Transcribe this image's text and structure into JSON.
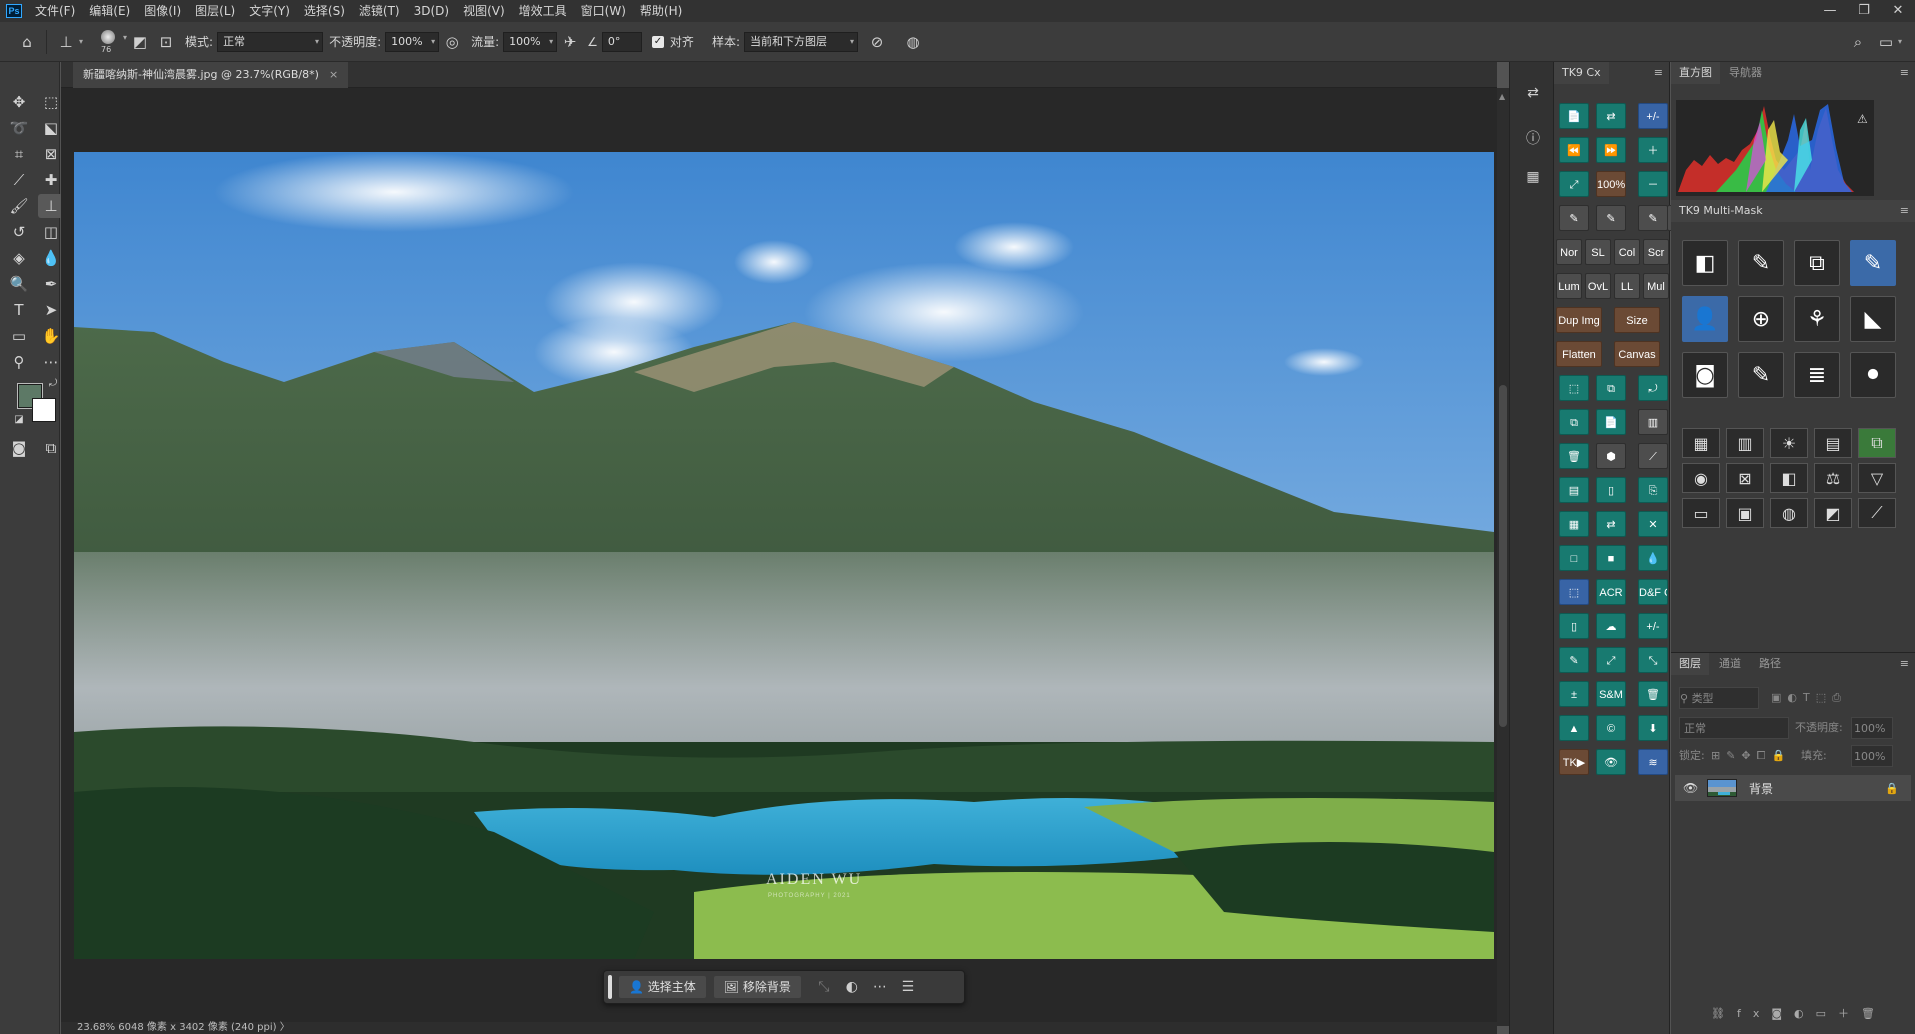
{
  "menubar": {
    "logo": "Ps",
    "items": [
      "文件(F)",
      "编辑(E)",
      "图像(I)",
      "图层(L)",
      "文字(Y)",
      "选择(S)",
      "滤镜(T)",
      "3D(D)",
      "视图(V)",
      "增效工具",
      "窗口(W)",
      "帮助(H)"
    ]
  },
  "options": {
    "brush_size": "76",
    "mode_label": "模式:",
    "mode_value": "正常",
    "opacity_label": "不透明度:",
    "opacity_value": "100%",
    "flow_label": "流量:",
    "flow_value": "100%",
    "angle_value": "0°",
    "align_label": "对齐",
    "sample_label": "样本:",
    "sample_value": "当前和下方图层"
  },
  "document": {
    "tab_title": "新疆喀纳斯-神仙湾晨雾.jpg @ 23.7%(RGB/8*)",
    "watermark": "AIDEN WU",
    "watermark_sub": "PHOTOGRAPHY | 2021"
  },
  "status": {
    "text": "23.68%   6048 像素 x 3402 像素 (240 ppi)   〉"
  },
  "context_bar": {
    "select_subject": "选择主体",
    "remove_bg": "移除背景"
  },
  "tk9": {
    "tab": "TK9 Cx",
    "zoom_label": "100%",
    "blend_modes": [
      "Nor",
      "SL",
      "Col",
      "Scr",
      "Lum",
      "OvL",
      "LL",
      "Mul"
    ],
    "dup_img": "Dup Img",
    "size": "Size",
    "flatten": "Flatten",
    "canvas": "Canvas",
    "acr": "ACR",
    "dfcaf": "D&F CAF",
    "plus_minus": "+/-",
    "sm": "S&M",
    "tk": "TK▶"
  },
  "right_panels": {
    "histogram_tab": "直方图",
    "navigator_tab": "导航器",
    "multimask_title": "TK9 Multi-Mask",
    "layers_tab": "图层",
    "channels_tab": "通道",
    "paths_tab": "路径",
    "kind_placeholder": "类型",
    "blend_value": "正常",
    "opacity_label": "不透明度:",
    "opacity_value": "100%",
    "lock_label": "锁定:",
    "fill_label": "填充:",
    "fill_value": "100%",
    "layer_name": "背景"
  },
  "colors": {
    "foreground": "#5d7966",
    "background": "#ffffff",
    "tk9_teal": "#187a70"
  }
}
